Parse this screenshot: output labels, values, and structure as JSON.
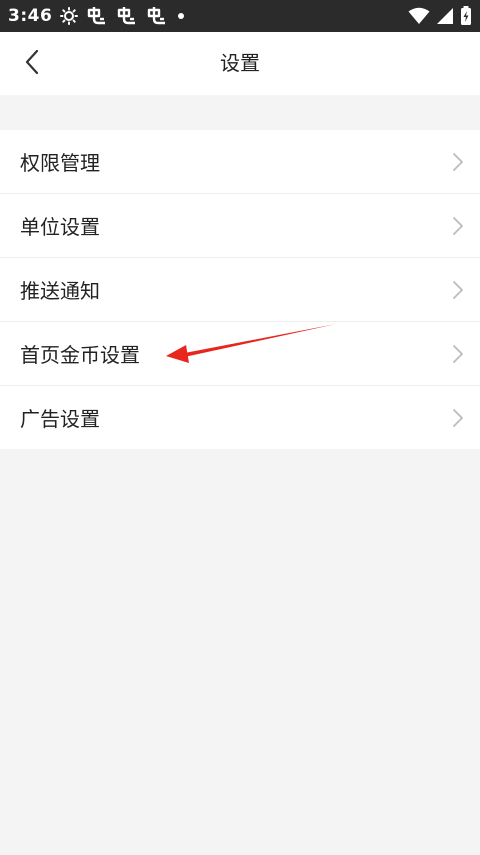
{
  "status_bar": {
    "time": "3:46",
    "icons_left": [
      "brightness-icon",
      "notification-app-icon",
      "notification-app-icon",
      "notification-app-icon",
      "dot-icon"
    ],
    "icons_right": [
      "wifi-icon",
      "signal-icon",
      "battery-charging-icon"
    ]
  },
  "header": {
    "title": "设置",
    "back_icon": "chevron-left-icon"
  },
  "settings": {
    "items": [
      {
        "label": "权限管理"
      },
      {
        "label": "单位设置"
      },
      {
        "label": "推送通知"
      },
      {
        "label": "首页金币设置"
      },
      {
        "label": "广告设置"
      }
    ]
  },
  "colors": {
    "status_bar_bg": "#2b2b2b",
    "page_bg": "#f4f4f4",
    "card_bg": "#ffffff",
    "text_primary": "#222222",
    "chevron": "#bbbbbb",
    "annotation_arrow": "#e8261c"
  }
}
